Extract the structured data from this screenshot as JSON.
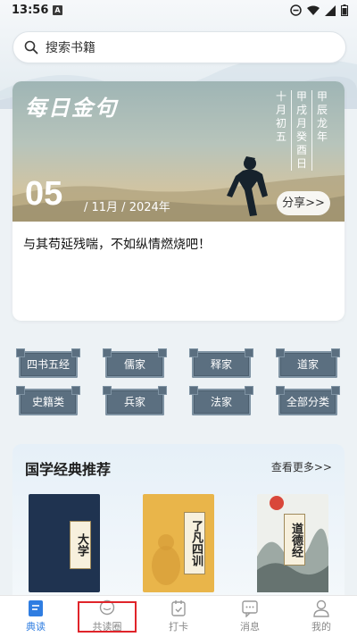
{
  "status": {
    "time": "13:56",
    "app_badge": "A"
  },
  "search": {
    "placeholder": "搜索书籍"
  },
  "daily": {
    "title": "每日金句",
    "lunar_col1": "十月初五",
    "lunar_col2": "甲戌月癸酉日",
    "lunar_col3": "甲辰龙年",
    "day": "05",
    "month_year": "/ 11月 / 2024年",
    "share_label": "分享>>",
    "quote": "与其苟延残喘，不如纵情燃烧吧！"
  },
  "categories": [
    "四书五经",
    "儒家",
    "释家",
    "道家",
    "史籍类",
    "兵家",
    "法家",
    "全部分类"
  ],
  "recommend": {
    "title": "国学经典推荐",
    "more_label": "查看更多>>",
    "books": [
      {
        "title": "大学"
      },
      {
        "title": "了凡四训"
      },
      {
        "title": "道德经"
      }
    ]
  },
  "nav": {
    "items": [
      {
        "label": "典读",
        "icon": "book-icon",
        "active": true
      },
      {
        "label": "共读圈",
        "icon": "chat-bubble-icon",
        "active": false
      },
      {
        "label": "打卡",
        "icon": "calendar-check-icon",
        "active": false
      },
      {
        "label": "消息",
        "icon": "message-icon",
        "active": false
      },
      {
        "label": "我的",
        "icon": "person-icon",
        "active": false
      }
    ]
  },
  "colors": {
    "accent": "#2f7de1",
    "category_tile": "#5b6f80",
    "highlight": "#e0242a"
  }
}
